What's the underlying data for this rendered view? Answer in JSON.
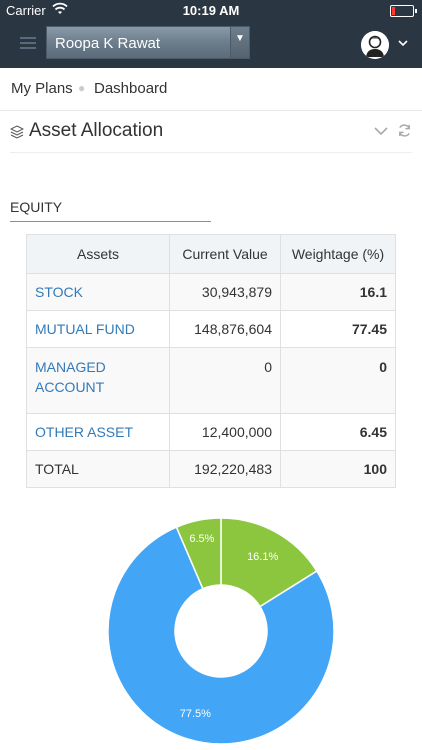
{
  "status_bar": {
    "carrier": "Carrier",
    "time": "10:19 AM"
  },
  "header": {
    "user_name": "Roopa K Rawat"
  },
  "breadcrumb": {
    "items": [
      "My Plans",
      "Dashboard"
    ]
  },
  "section": {
    "title": "Asset Allocation"
  },
  "tabs": {
    "equity": "EQUITY"
  },
  "table": {
    "headers": [
      "Assets",
      "Current Value",
      "Weightage (%)"
    ],
    "rows": [
      {
        "asset": "STOCK",
        "value": "30,943,879",
        "weight": "16.1"
      },
      {
        "asset": "MUTUAL FUND",
        "value": "148,876,604",
        "weight": "77.45"
      },
      {
        "asset": "MANAGED ACCOUNT",
        "value": "0",
        "weight": "0"
      },
      {
        "asset": "OTHER ASSET",
        "value": "12,400,000",
        "weight": "6.45"
      }
    ],
    "total": {
      "label": "TOTAL",
      "value": "192,220,483",
      "weight": "100"
    }
  },
  "colors": {
    "header_bg": "#2b3643",
    "link": "#337ab7",
    "stock": "#8cc63f",
    "mutual_fund": "#42a5f5",
    "other": "#8cc63f"
  },
  "chart_data": {
    "type": "pie",
    "donut": true,
    "slices": [
      {
        "label": "16.1%",
        "value": 16.1,
        "color": "#8cc63f"
      },
      {
        "label": "77.5%",
        "value": 77.45,
        "color": "#42a5f5"
      },
      {
        "label": "",
        "value": 0,
        "color": "#8cc63f"
      },
      {
        "label": "6.5%",
        "value": 6.45,
        "color": "#8cc63f"
      }
    ]
  }
}
